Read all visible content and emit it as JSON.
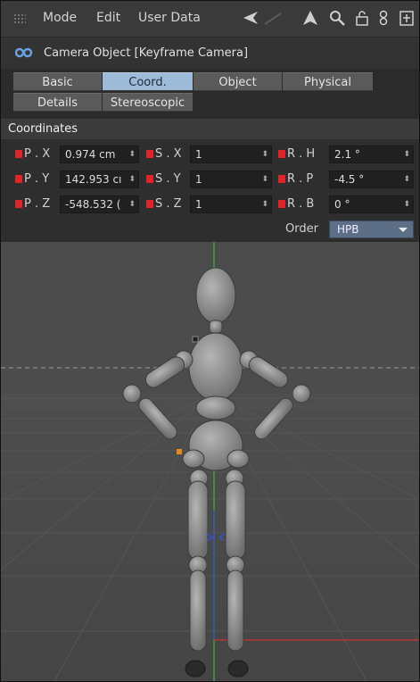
{
  "menubar": {
    "items": [
      "Mode",
      "Edit",
      "User Data"
    ],
    "icons": [
      "back-arrow-icon",
      "up-arrow-icon",
      "search-icon",
      "lock-icon",
      "link-icon",
      "new-panel-icon"
    ]
  },
  "object": {
    "title": "Camera Object [Keyframe Camera]",
    "icon": "camera-object-icon"
  },
  "tabs": [
    {
      "label": "Basic",
      "active": false
    },
    {
      "label": "Coord.",
      "active": true
    },
    {
      "label": "Object",
      "active": false
    },
    {
      "label": "Physical",
      "active": false
    },
    {
      "label": "Details",
      "active": false
    },
    {
      "label": "Stereoscopic",
      "active": false
    }
  ],
  "section": {
    "title": "Coordinates"
  },
  "coordinates": {
    "p_x": {
      "label": "P . X",
      "value": "0.974 cm"
    },
    "p_y": {
      "label": "P . Y",
      "value": "142.953 cı"
    },
    "p_z": {
      "label": "P . Z",
      "value": "-548.532 ("
    },
    "s_x": {
      "label": "S . X",
      "value": "1"
    },
    "s_y": {
      "label": "S . Y",
      "value": "1"
    },
    "s_z": {
      "label": "S . Z",
      "value": "1"
    },
    "r_h": {
      "label": "R . H",
      "value": "2.1 °"
    },
    "r_p": {
      "label": "R . P",
      "value": "-4.5 °"
    },
    "r_b": {
      "label": "R . B",
      "value": "0 °"
    }
  },
  "order": {
    "label": "Order",
    "value": "HPB"
  },
  "colors": {
    "active_tab": "#9dbbd8",
    "keyframe_dot": "#e0242a",
    "y_axis": "#2fbf2f",
    "x_axis": "#c83232",
    "z_axis": "#3a4fd0",
    "select_bg": "#5c6f86"
  },
  "viewport": {
    "subject": "wooden-mannequin-figure"
  }
}
